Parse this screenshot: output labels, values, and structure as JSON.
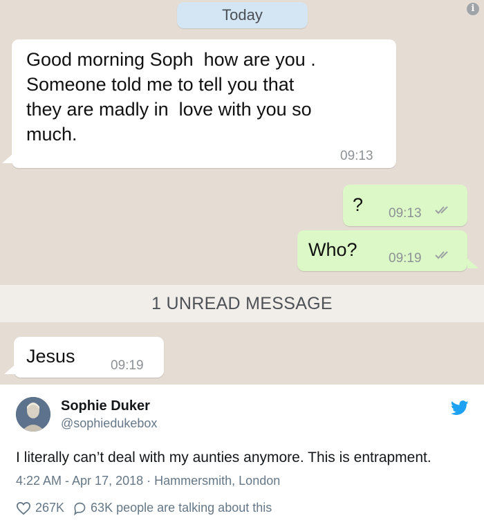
{
  "chat": {
    "date_label": "Today",
    "info_icon": "info-icon",
    "unread_label": "1 UNREAD MESSAGE",
    "messages": [
      {
        "direction": "incoming",
        "text": "Good morning Soph  how are you .\nSomeone told me to tell you that\nthey are madly in  love with you so\nmuch.",
        "time": "09:13"
      },
      {
        "direction": "outgoing",
        "text": "?",
        "time": "09:13",
        "status": "double-check-icon"
      },
      {
        "direction": "outgoing",
        "text": "Who?",
        "time": "09:19",
        "status": "double-check-icon"
      },
      {
        "direction": "incoming",
        "text": "Jesus",
        "time": "09:19"
      }
    ]
  },
  "tweet": {
    "name": "Sophie Duker",
    "handle": "@sophiedukebox",
    "text": "I literally can’t deal with my aunties anymore. This is entrapment.",
    "timestamp": "4:22 AM - Apr 17, 2018",
    "separator": "·",
    "location": "Hammersmith, London",
    "likes": "267K",
    "talking": "63K people are talking about this",
    "brand_color": "#1da1f2"
  }
}
